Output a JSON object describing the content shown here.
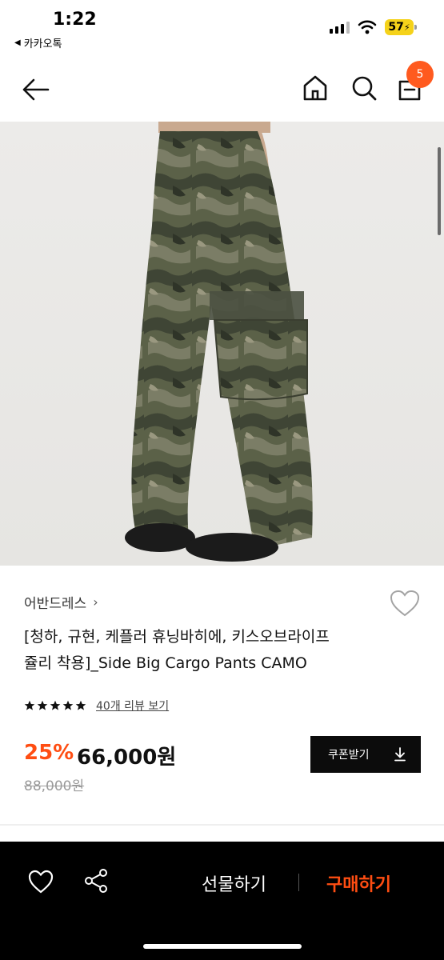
{
  "status_bar": {
    "time": "1:22",
    "back_app": "카카오톡",
    "battery": "57"
  },
  "nav": {
    "cart_count": "5"
  },
  "product": {
    "brand": "어반드레스",
    "title_line1": "[청하, 규현, 케플러 휴닝바히에, 키스오브라이프",
    "title_line2": "쥴리 착용]_Side Big Cargo Pants CAMO",
    "rating_stars": 5,
    "review_link": "40개 리뷰 보기",
    "discount": "25%",
    "price": "66,000원",
    "original_price": "88,000원",
    "coupon_label": "쿠폰받기"
  },
  "bottom_bar": {
    "gift_label": "선물하기",
    "buy_label": "구매하기"
  },
  "colors": {
    "accent": "#ff4d12",
    "badge": "#ff5a1f",
    "battery": "#f5d21a"
  }
}
